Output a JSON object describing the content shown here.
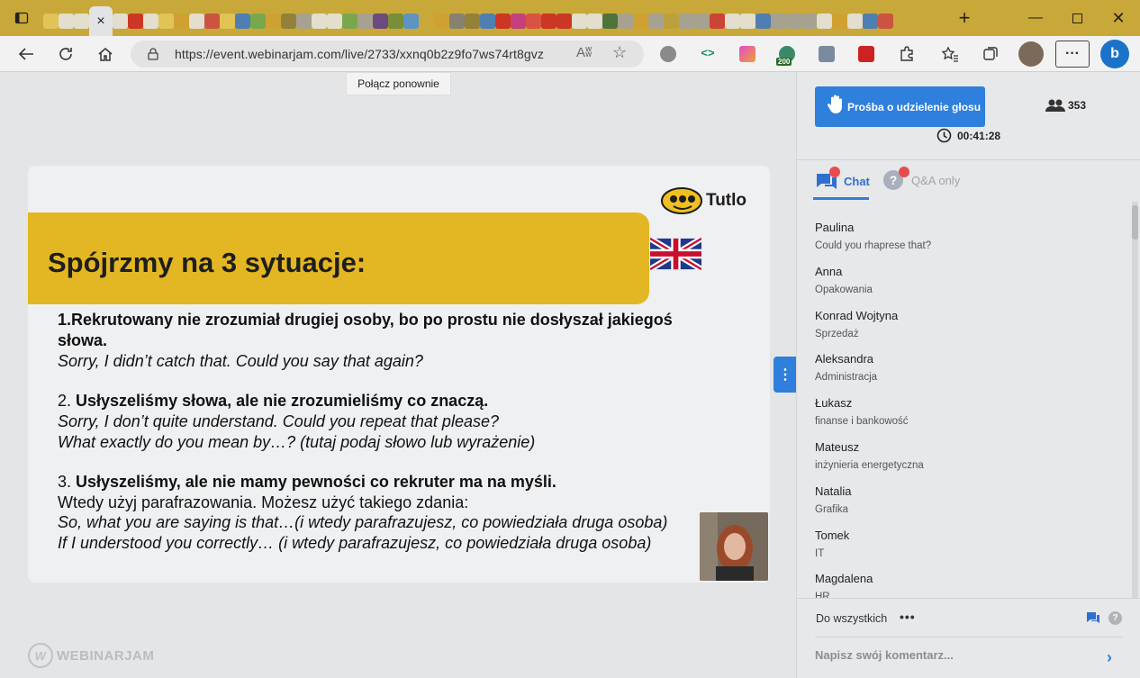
{
  "browser": {
    "url": "https://event.webinarjam.com/live/2733/xxnq0b2z9fo7ws74rt8gvz",
    "active_tab_close": "×",
    "new_tab": "+",
    "tooltip": "Połącz ponownie",
    "favicon_colors": [
      "#e6c85a",
      "#e8e8e8",
      "#e8e8e8",
      "#e8e8e8",
      "#cc2222",
      "#e8e8e8",
      "#e6c85a",
      "#d0a030",
      "#e8e8e8",
      "#cc4444",
      "#e6c85a",
      "#3a78c8",
      "#6aa84f",
      "#d0a030",
      "#8a7a3a",
      "#a0a0a0",
      "#e8e8e8",
      "#e8e8e8",
      "#6aa84f",
      "#a0a0a0",
      "#5a3a8a",
      "#6a8a3a",
      "#4a90d9",
      "#c9a83a",
      "#d0a030",
      "#7a7a7a",
      "#8a7a3a",
      "#3a78c8",
      "#cc2222",
      "#c52d8a",
      "#d44",
      "#cc2222",
      "#cc2222",
      "#e8e8e8",
      "#e8e8e8",
      "#3a6a3a",
      "#a0a0a0",
      "#d0a030",
      "#a0a0a0",
      "#b8a040",
      "#a0a0a0",
      "#a0a0a0",
      "#cc3333",
      "#e8e8e8",
      "#e8e8e8",
      "#3a78c8",
      "#a0a0a0",
      "#a0a0a0",
      "#a0a0a0",
      "#e8e8e8",
      "#d0a030",
      "#e8e8e8",
      "#3a78c8",
      "#cc4444"
    ],
    "extension_badge": "200",
    "read_aloud": "Aʬ"
  },
  "slide": {
    "logo": "Tutlo",
    "title": "Spójrzmy na 3 sytuacje:",
    "p1_bold_line1": "1.Rekrutowany nie zrozumiał drugiej osoby, bo po prostu nie dosłyszał jakiegoś",
    "p1_bold_line2": "słowa.",
    "p1_italic": "Sorry, I didn’t catch that. Could you say that again?",
    "p2_prefix": "2. ",
    "p2_bold": "Usłyszeliśmy słowa, ale nie zrozumieliśmy co znaczą.",
    "p2_italic1": "Sorry, I don’t quite understand. Could you repeat that please?",
    "p2_italic2": "What exactly do you mean by…? (tutaj podaj słowo lub wyrażenie)",
    "p3_prefix": "3. ",
    "p3_bold": "Usłyszeliśmy, ale nie mamy pewności co rekruter ma na myśli.",
    "p3_plain": "Wtedy użyj parafrazowania. Możesz użyć takiego zdania:",
    "p3_italic1": "So, what you are saying is that…(i wtedy parafrazujesz, co powiedziała druga osoba)",
    "p3_italic2": "If I understood you correctly… (i wtedy parafrazujesz, co powiedziała druga osoba)"
  },
  "branding": {
    "webinarjam": "WEBINARJAM",
    "wj_mark": "W"
  },
  "sidebar": {
    "raise_hand_label": "Prośba o udzielenie głosu",
    "attendees_count": "353",
    "timer": "00:41:28",
    "tabs": [
      {
        "label": "Chat",
        "active": true
      },
      {
        "label": "Q&A only",
        "active": false
      }
    ],
    "messages": [
      {
        "name": "Paulina",
        "text": "Could you rhaprese that?"
      },
      {
        "name": "Anna",
        "text": "Opakowania"
      },
      {
        "name": "Konrad Wojtyna",
        "text": "Sprzedaż"
      },
      {
        "name": "Aleksandra",
        "text": "Administracja"
      },
      {
        "name": "Łukasz",
        "text": "finanse i bankowość"
      },
      {
        "name": "Mateusz",
        "text": "inżynieria energetyczna"
      },
      {
        "name": "Natalia",
        "text": "Grafika"
      },
      {
        "name": "Tomek",
        "text": "IT"
      },
      {
        "name": "Magdalena",
        "text": "HR"
      }
    ],
    "recipient": "Do wszystkich",
    "recipient_more": "•••",
    "comment_placeholder": "Napisz swój komentarz...",
    "qa_icon_text": "?"
  },
  "colors": {
    "accent": "#2f7fdc",
    "banner": "#e3b724",
    "badge": "#e74c4c"
  }
}
